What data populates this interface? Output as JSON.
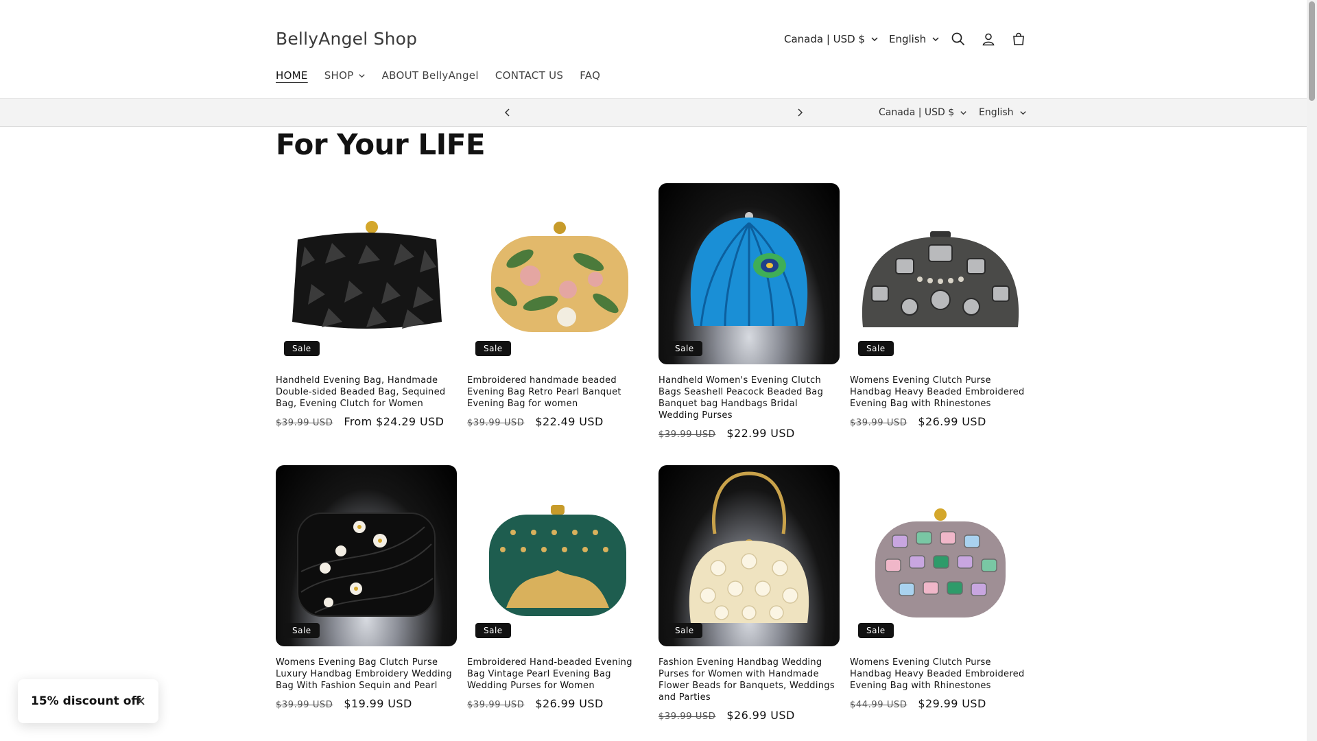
{
  "header": {
    "logo": "BellyAngel Shop",
    "country_selector": "Canada | USD $",
    "language_selector": "English",
    "icons": [
      "search-icon",
      "account-icon",
      "cart-icon"
    ]
  },
  "nav": {
    "items": [
      {
        "label": "HOME",
        "active": true
      },
      {
        "label": "SHOP",
        "has_dropdown": true
      },
      {
        "label": "ABOUT BellyAngel"
      },
      {
        "label": "CONTACT US"
      },
      {
        "label": "FAQ"
      }
    ]
  },
  "utility_bar": {
    "country_selector": "Canada | USD $",
    "language_selector": "English"
  },
  "section": {
    "title": "For Your LIFE"
  },
  "products": [
    {
      "title": "Handheld Evening Bag, Handmade Double-sided Beaded Bag, Sequined Bag, Evening Clutch for Women",
      "badge": "Sale",
      "compare_price": "$39.99 USD",
      "price": "From $24.29 USD",
      "color": "#151515"
    },
    {
      "title": "Embroidered handmade beaded Evening Bag Retro Pearl Banquet Evening Bag for women",
      "badge": "Sale",
      "compare_price": "$39.99 USD",
      "price": "$22.49 USD",
      "color": "#e2b96b"
    },
    {
      "title": "Handheld Women's Evening Clutch Bags Seashell Peacock Beaded Bag Banquet bag Handbags Bridal Wedding Purses",
      "badge": "Sale",
      "compare_price": "$39.99 USD",
      "price": "$22.99 USD",
      "color": "#1a8fd6"
    },
    {
      "title": "Womens Evening Clutch Purse Handbag Heavy Beaded Embroidered Evening Bag with Rhinestones",
      "badge": "Sale",
      "compare_price": "$39.99 USD",
      "price": "$26.99 USD",
      "color": "#4a4a48"
    },
    {
      "title": "Womens Evening Bag Clutch Purse Luxury Handbag Embroidery Wedding Bag With Fashion Sequin and Pearl",
      "badge": "Sale",
      "compare_price": "$39.99 USD",
      "price": "$19.99 USD",
      "color": "#0d0d0d"
    },
    {
      "title": "Embroidered Hand-beaded Evening Bag Vintage Pearl Evening Bag Wedding Purses for Women",
      "badge": "Sale",
      "compare_price": "$39.99 USD",
      "price": "$26.99 USD",
      "color": "#1e5d4f"
    },
    {
      "title": "Fashion Evening Handbag Wedding Purses for Women with Handmade Flower Beads for Banquets, Weddings and Parties",
      "badge": "Sale",
      "compare_price": "$39.99 USD",
      "price": "$26.99 USD",
      "color": "#efe3c0"
    },
    {
      "title": "Womens Evening Clutch Purse Handbag Heavy Beaded Embroidered Evening Bag with Rhinestones",
      "badge": "Sale",
      "compare_price": "$44.99 USD",
      "price": "$29.99 USD",
      "color": "#9f8f95"
    }
  ],
  "discount_popup": {
    "text": "15% discount off"
  }
}
